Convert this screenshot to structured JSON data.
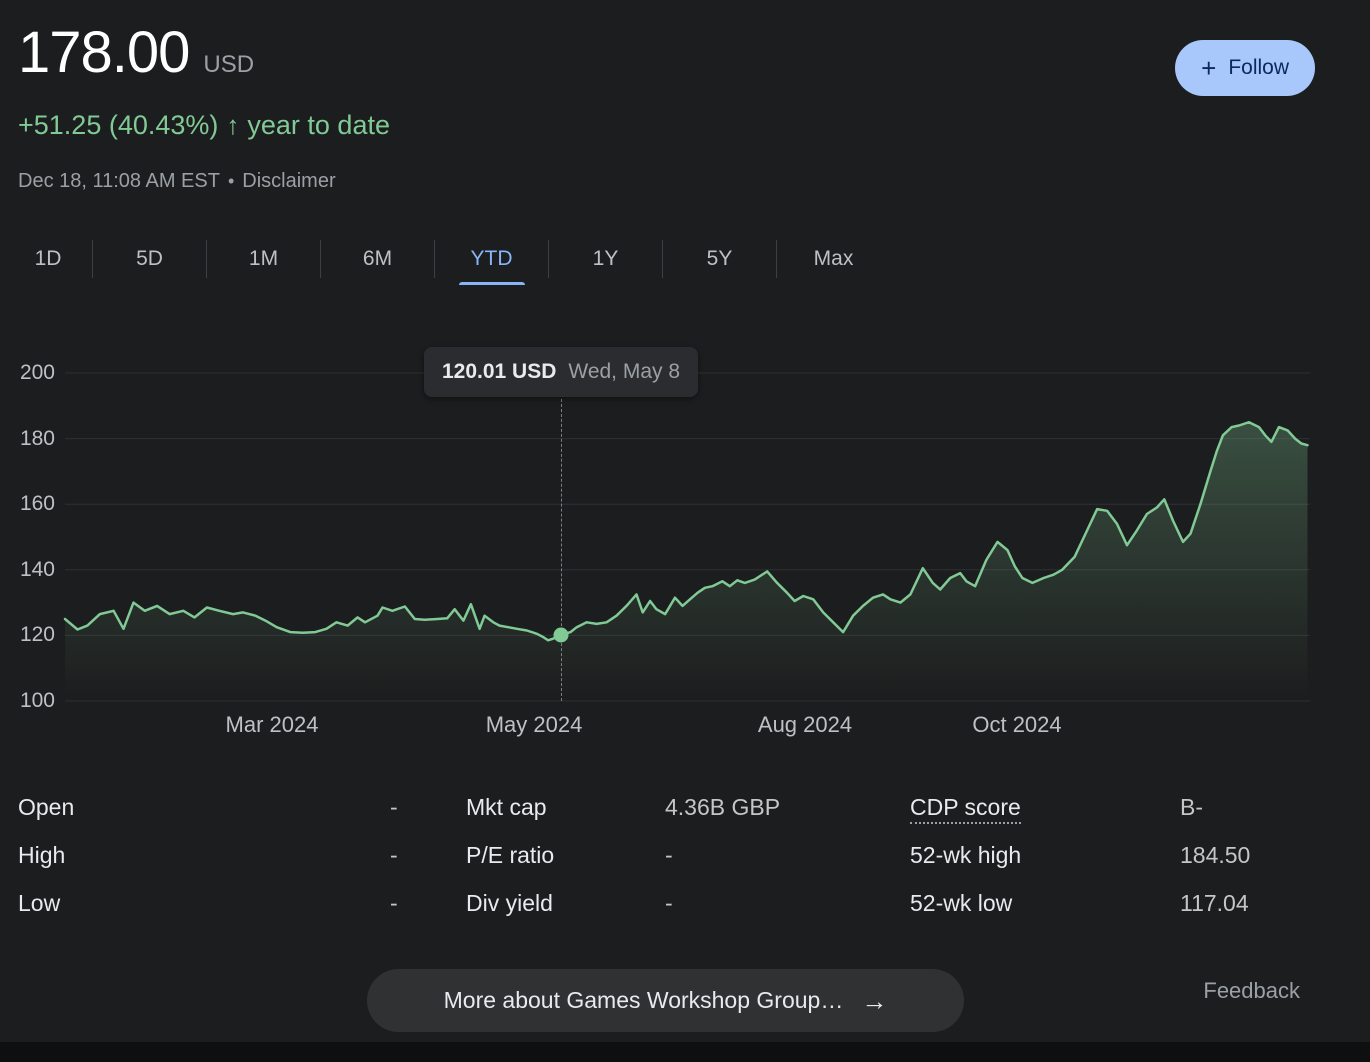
{
  "header": {
    "price": "178.00",
    "currency": "USD",
    "change": "+51.25 (40.43%)",
    "change_period": "year to date",
    "timestamp": "Dec 18, 11:08 AM EST",
    "separator": "•",
    "disclaimer": "Disclaimer",
    "follow_label": "Follow",
    "plus_icon": "+"
  },
  "tabs": [
    {
      "label": "1D",
      "selected": false
    },
    {
      "label": "5D",
      "selected": false
    },
    {
      "label": "1M",
      "selected": false
    },
    {
      "label": "6M",
      "selected": false
    },
    {
      "label": "YTD",
      "selected": true
    },
    {
      "label": "1Y",
      "selected": false
    },
    {
      "label": "5Y",
      "selected": false
    },
    {
      "label": "Max",
      "selected": false
    }
  ],
  "colors": {
    "positive_green": "#81c995",
    "chart_green": "#81c995",
    "accent_blue": "#8ab4f8",
    "follow_bg": "#a8c7fa",
    "gridline": "#2e3033"
  },
  "stats": {
    "col1": [
      {
        "label": "Open",
        "value": "-"
      },
      {
        "label": "High",
        "value": "-"
      },
      {
        "label": "Low",
        "value": "-"
      }
    ],
    "col2": [
      {
        "label": "Mkt cap",
        "value": "4.36B GBP"
      },
      {
        "label": "P/E ratio",
        "value": "-"
      },
      {
        "label": "Div yield",
        "value": "-"
      }
    ],
    "col3": [
      {
        "label": "CDP score",
        "value": "B-"
      },
      {
        "label": "52-wk high",
        "value": "184.50"
      },
      {
        "label": "52-wk low",
        "value": "117.04"
      }
    ]
  },
  "footer": {
    "more_label": "More about Games Workshop Group…",
    "arrow_icon": "→",
    "feedback": "Feedback"
  },
  "chart_data": {
    "type": "line",
    "currency": "USD",
    "period": "YTD",
    "ylim": [
      100,
      200
    ],
    "yticks": [
      100,
      120,
      140,
      160,
      180,
      200
    ],
    "grid": true,
    "xticks": [
      {
        "label": "Mar 2024",
        "x": 0.166
      },
      {
        "label": "May 2024",
        "x": 0.377
      },
      {
        "label": "Aug 2024",
        "x": 0.594
      },
      {
        "label": "Oct 2024",
        "x": 0.765
      }
    ],
    "marker": {
      "x": 0.398,
      "price": 120.01,
      "label_price": "120.01 USD",
      "label_date": "Wed, May 8"
    },
    "points": [
      [
        0.0,
        125.0
      ],
      [
        0.01,
        121.8
      ],
      [
        0.018,
        123.0
      ],
      [
        0.028,
        126.5
      ],
      [
        0.039,
        127.5
      ],
      [
        0.047,
        122.0
      ],
      [
        0.055,
        130.0
      ],
      [
        0.064,
        127.5
      ],
      [
        0.074,
        129.0
      ],
      [
        0.084,
        126.5
      ],
      [
        0.095,
        127.5
      ],
      [
        0.104,
        125.5
      ],
      [
        0.114,
        128.5
      ],
      [
        0.124,
        127.5
      ],
      [
        0.135,
        126.5
      ],
      [
        0.143,
        127.0
      ],
      [
        0.153,
        126.0
      ],
      [
        0.161,
        124.5
      ],
      [
        0.17,
        122.5
      ],
      [
        0.181,
        121.0
      ],
      [
        0.191,
        120.8
      ],
      [
        0.201,
        121.0
      ],
      [
        0.21,
        122.0
      ],
      [
        0.218,
        124.0
      ],
      [
        0.227,
        123.0
      ],
      [
        0.235,
        125.5
      ],
      [
        0.241,
        124.0
      ],
      [
        0.251,
        126.0
      ],
      [
        0.255,
        128.5
      ],
      [
        0.263,
        127.5
      ],
      [
        0.273,
        128.8
      ],
      [
        0.281,
        125.0
      ],
      [
        0.289,
        124.8
      ],
      [
        0.299,
        125.0
      ],
      [
        0.307,
        125.2
      ],
      [
        0.313,
        128.0
      ],
      [
        0.32,
        124.5
      ],
      [
        0.326,
        129.5
      ],
      [
        0.333,
        122.0
      ],
      [
        0.337,
        126.0
      ],
      [
        0.344,
        124.0
      ],
      [
        0.349,
        123.0
      ],
      [
        0.356,
        122.5
      ],
      [
        0.363,
        122.0
      ],
      [
        0.371,
        121.5
      ],
      [
        0.379,
        120.5
      ],
      [
        0.384,
        119.5
      ],
      [
        0.388,
        118.5
      ],
      [
        0.392,
        119.0
      ],
      [
        0.398,
        120.01
      ],
      [
        0.406,
        121.0
      ],
      [
        0.411,
        122.5
      ],
      [
        0.419,
        124.0
      ],
      [
        0.427,
        123.5
      ],
      [
        0.435,
        124.0
      ],
      [
        0.443,
        126.0
      ],
      [
        0.451,
        129.0
      ],
      [
        0.459,
        132.5
      ],
      [
        0.464,
        127.0
      ],
      [
        0.47,
        130.5
      ],
      [
        0.475,
        128.0
      ],
      [
        0.482,
        126.5
      ],
      [
        0.49,
        131.5
      ],
      [
        0.496,
        129.0
      ],
      [
        0.502,
        131.0
      ],
      [
        0.508,
        133.0
      ],
      [
        0.514,
        134.5
      ],
      [
        0.52,
        135.0
      ],
      [
        0.528,
        136.5
      ],
      [
        0.534,
        135.0
      ],
      [
        0.54,
        136.8
      ],
      [
        0.546,
        136.0
      ],
      [
        0.554,
        137.0
      ],
      [
        0.564,
        139.5
      ],
      [
        0.572,
        136.0
      ],
      [
        0.58,
        133.0
      ],
      [
        0.586,
        130.5
      ],
      [
        0.593,
        132.0
      ],
      [
        0.601,
        131.0
      ],
      [
        0.609,
        127.0
      ],
      [
        0.617,
        124.0
      ],
      [
        0.625,
        121.0
      ],
      [
        0.633,
        126.0
      ],
      [
        0.641,
        129.0
      ],
      [
        0.649,
        131.5
      ],
      [
        0.657,
        132.5
      ],
      [
        0.663,
        131.0
      ],
      [
        0.671,
        130.0
      ],
      [
        0.679,
        132.5
      ],
      [
        0.689,
        140.5
      ],
      [
        0.697,
        136.0
      ],
      [
        0.703,
        134.0
      ],
      [
        0.711,
        137.5
      ],
      [
        0.719,
        139.0
      ],
      [
        0.724,
        136.5
      ],
      [
        0.731,
        135.0
      ],
      [
        0.74,
        143.0
      ],
      [
        0.749,
        148.5
      ],
      [
        0.757,
        146.0
      ],
      [
        0.763,
        141.0
      ],
      [
        0.769,
        137.5
      ],
      [
        0.777,
        136.0
      ],
      [
        0.786,
        137.5
      ],
      [
        0.794,
        138.5
      ],
      [
        0.801,
        140.0
      ],
      [
        0.811,
        144.0
      ],
      [
        0.821,
        152.0
      ],
      [
        0.829,
        158.5
      ],
      [
        0.837,
        158.0
      ],
      [
        0.845,
        154.0
      ],
      [
        0.853,
        147.5
      ],
      [
        0.861,
        152.0
      ],
      [
        0.869,
        157.0
      ],
      [
        0.877,
        159.0
      ],
      [
        0.883,
        161.5
      ],
      [
        0.89,
        155.0
      ],
      [
        0.898,
        148.5
      ],
      [
        0.904,
        151.0
      ],
      [
        0.912,
        160.0
      ],
      [
        0.92,
        170.0
      ],
      [
        0.925,
        176.0
      ],
      [
        0.93,
        181.0
      ],
      [
        0.937,
        183.5
      ],
      [
        0.943,
        184.0
      ],
      [
        0.951,
        185.0
      ],
      [
        0.959,
        183.5
      ],
      [
        0.964,
        181.0
      ],
      [
        0.969,
        179.0
      ],
      [
        0.975,
        183.5
      ],
      [
        0.982,
        182.5
      ],
      [
        0.988,
        180.0
      ],
      [
        0.993,
        178.5
      ],
      [
        0.998,
        178.0
      ]
    ]
  }
}
